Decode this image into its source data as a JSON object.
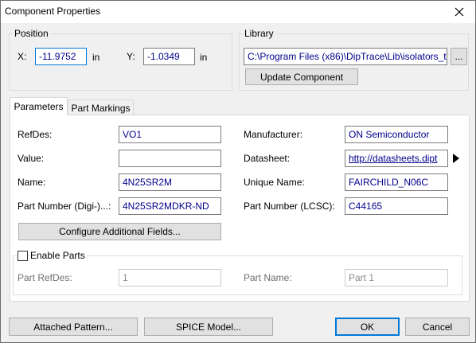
{
  "window": {
    "title": "Component Properties"
  },
  "position": {
    "group_label": "Position",
    "x_label": "X:",
    "x_value": "-11.9752",
    "x_unit": "in",
    "y_label": "Y:",
    "y_value": "-1.0349",
    "y_unit": "in"
  },
  "library": {
    "group_label": "Library",
    "path": "C:\\Program Files (x86)\\DipTrace\\Lib\\isolators_t",
    "browse_label": "...",
    "update_label": "Update Component"
  },
  "tabs": [
    {
      "label": "Parameters",
      "active": true
    },
    {
      "label": "Part Markings",
      "active": false
    }
  ],
  "params": {
    "refdes_label": "RefDes:",
    "refdes_value": "VO1",
    "value_label": "Value:",
    "value_value": "",
    "name_label": "Name:",
    "name_value": "4N25SR2M",
    "partnum_digi_label": "Part Number (Digi-)...:",
    "partnum_digi_value": "4N25SR2MDKR-ND",
    "manufacturer_label": "Manufacturer:",
    "manufacturer_value": "ON Semiconductor",
    "datasheet_label": "Datasheet:",
    "datasheet_value": "http://datasheets.dipt",
    "unique_name_label": "Unique Name:",
    "unique_name_value": "FAIRCHILD_N06C",
    "partnum_lcsc_label": "Part Number (LCSC):",
    "partnum_lcsc_value": "C44165",
    "configure_label": "Configure Additional Fields..."
  },
  "enable_parts": {
    "checkbox_label": "Enable Parts",
    "checked": false,
    "part_refdes_label": "Part RefDes:",
    "part_refdes_value": "1",
    "part_name_label": "Part Name:",
    "part_name_value": "Part 1"
  },
  "footer": {
    "attached_pattern_label": "Attached Pattern...",
    "spice_model_label": "SPICE Model...",
    "ok_label": "OK",
    "cancel_label": "Cancel"
  }
}
